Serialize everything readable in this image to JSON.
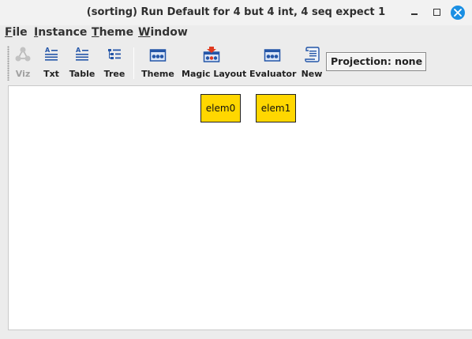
{
  "window": {
    "title": "(sorting) Run Default for 4 but 4 int, 4 seq expect 1",
    "controls": [
      "minimize-icon",
      "maximize-icon",
      "close-icon"
    ]
  },
  "menubar": {
    "items": [
      {
        "mnemonic": "F",
        "rest": "ile"
      },
      {
        "mnemonic": "I",
        "rest": "nstance"
      },
      {
        "mnemonic": "T",
        "rest": "heme"
      },
      {
        "mnemonic": "W",
        "rest": "indow"
      }
    ]
  },
  "toolbar": {
    "buttons": [
      {
        "label": "Viz",
        "icon": "graph-icon",
        "enabled": false
      },
      {
        "label": "Txt",
        "icon": "text-icon",
        "enabled": true
      },
      {
        "label": "Table",
        "icon": "table-icon",
        "enabled": true
      },
      {
        "label": "Tree",
        "icon": "tree-icon",
        "enabled": true
      },
      {
        "label": "Theme",
        "icon": "theme-icon",
        "enabled": true
      },
      {
        "label": "Magic Layout",
        "icon": "magic-layout-icon",
        "enabled": true
      },
      {
        "label": "Evaluator",
        "icon": "evaluator-icon",
        "enabled": true
      },
      {
        "label": "New",
        "icon": "scroll-icon",
        "enabled": true
      }
    ],
    "projection": "Projection: none"
  },
  "graph": {
    "nodes": [
      {
        "label": "elem0",
        "fill": "#ffd700"
      },
      {
        "label": "elem1",
        "fill": "#ffd700"
      }
    ]
  },
  "colors": {
    "node_fill": "#ffd700",
    "close_button": "#1a8fe3",
    "icon_blue": "#2456a8",
    "icon_red": "#e03a1f"
  }
}
